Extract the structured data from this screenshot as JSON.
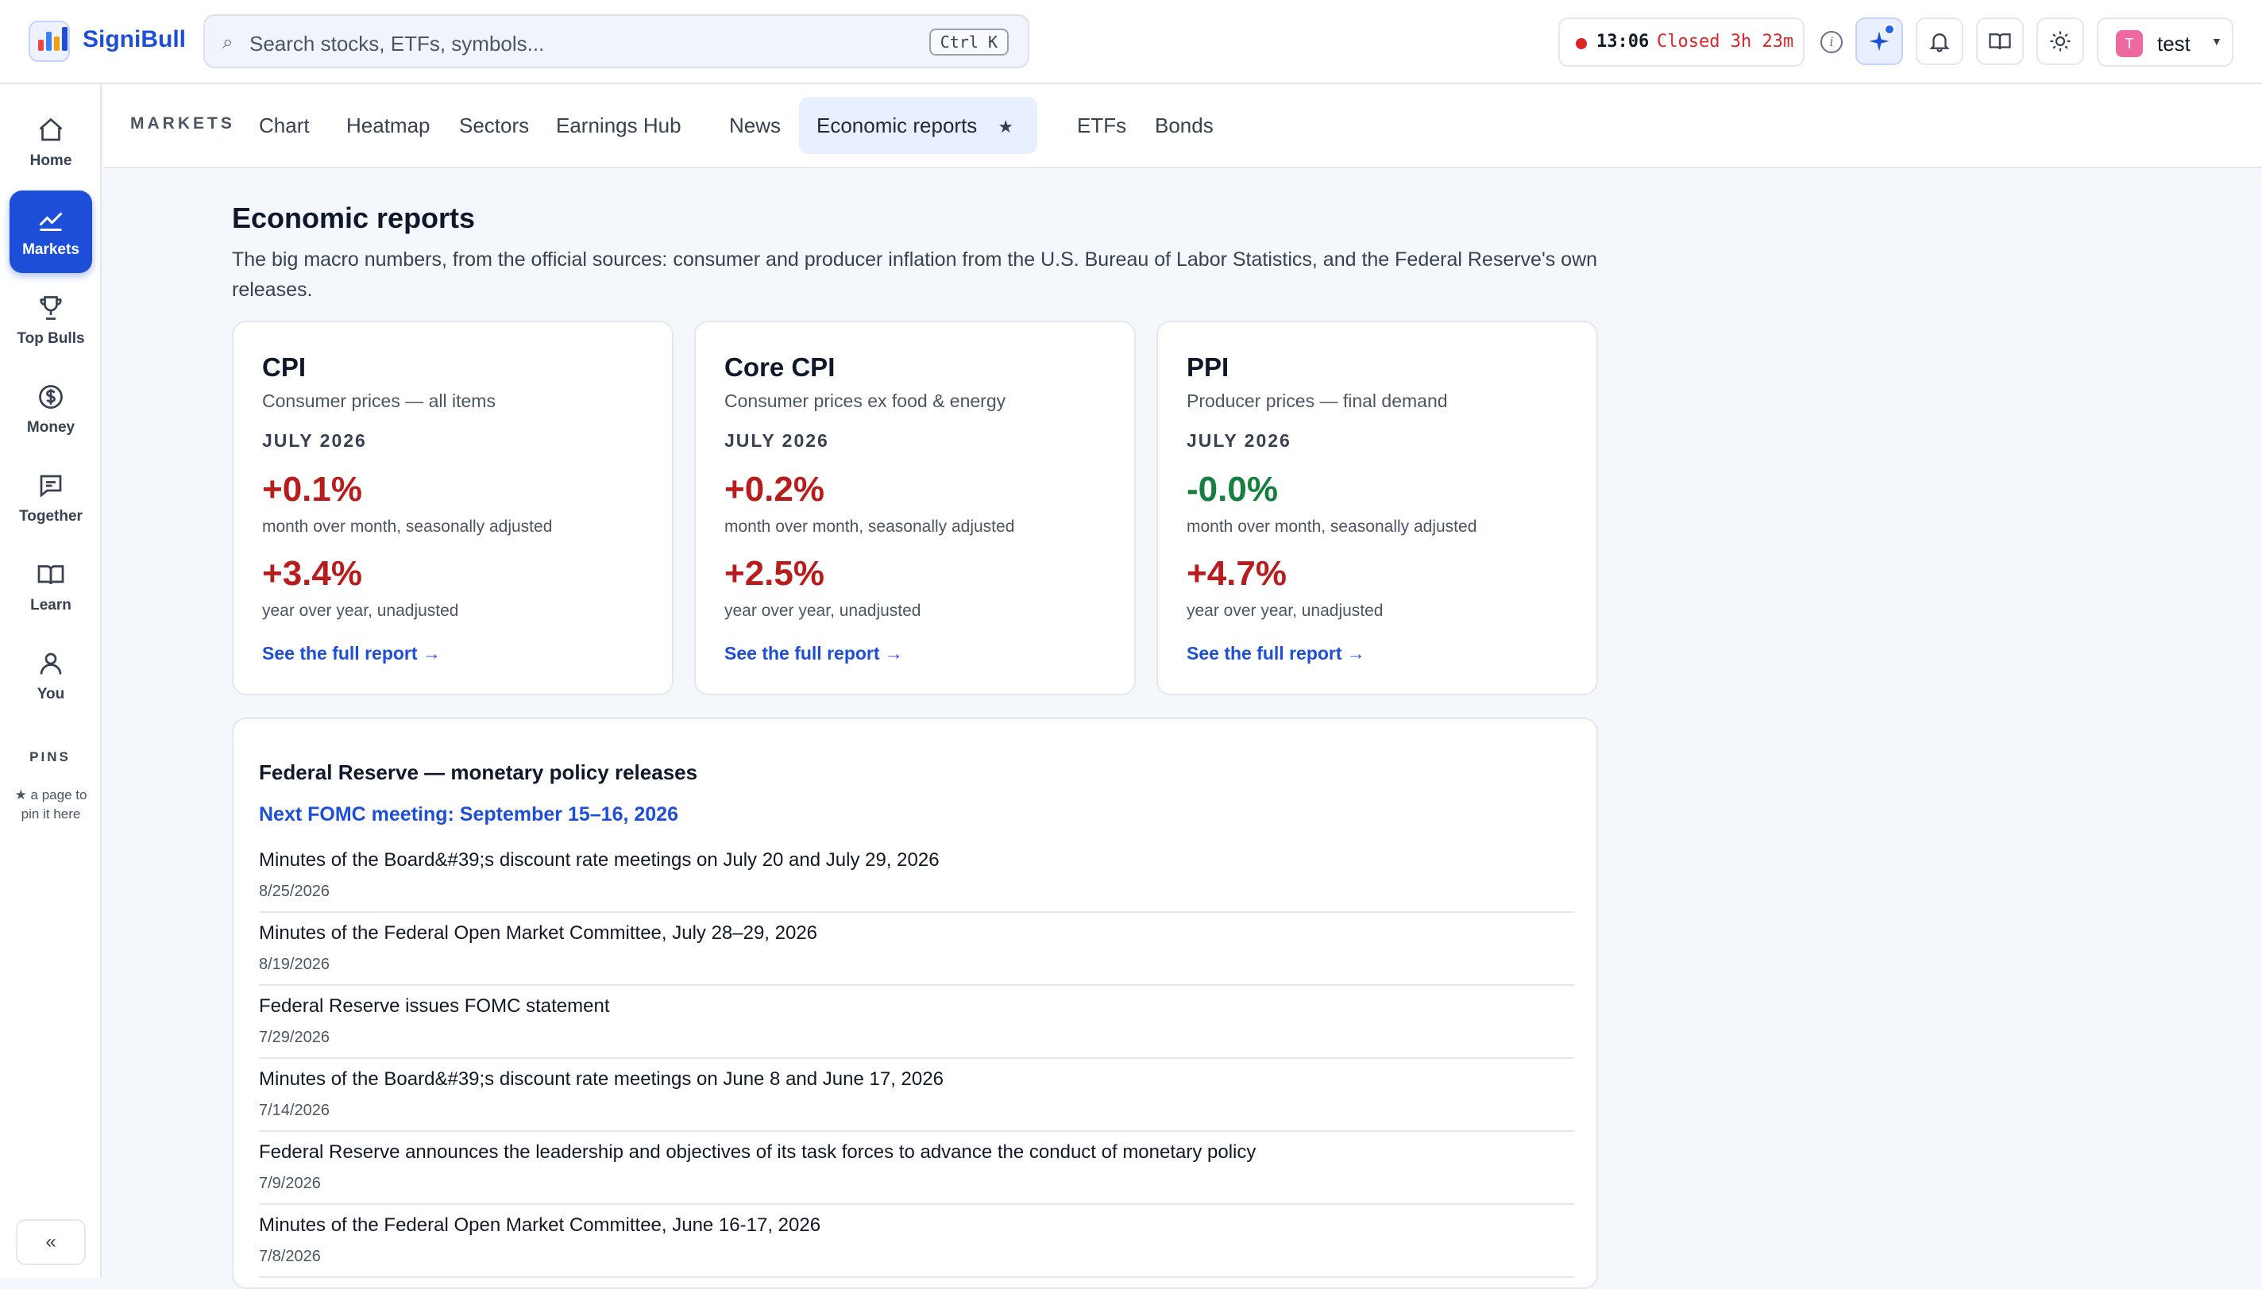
{
  "app": {
    "name": "SigniBull"
  },
  "search": {
    "placeholder": "Search stocks, ETFs, symbols...",
    "shortcut": "Ctrl K"
  },
  "market_status": {
    "time": "13:06",
    "state": "Closed 3h 23m"
  },
  "user": {
    "initial": "T",
    "name": "test"
  },
  "sidebar": {
    "items": [
      {
        "label": "Home"
      },
      {
        "label": "Markets"
      },
      {
        "label": "Top Bulls"
      },
      {
        "label": "Money"
      },
      {
        "label": "Together"
      },
      {
        "label": "Learn"
      },
      {
        "label": "You"
      }
    ],
    "pins_title": "PINS",
    "pins_hint": "★ a page to pin it here",
    "collapse": "«"
  },
  "subnav": {
    "title": "MARKETS",
    "tabs": [
      {
        "label": "Chart"
      },
      {
        "label": "Heatmap"
      },
      {
        "label": "Sectors"
      },
      {
        "label": "Earnings Hub"
      },
      {
        "label": "News"
      },
      {
        "label": "Economic reports",
        "star": "★"
      },
      {
        "label": "ETFs"
      },
      {
        "label": "Bonds"
      }
    ]
  },
  "page": {
    "title": "Economic reports",
    "description": "The big macro numbers, from the official sources: consumer and producer inflation from the U.S. Bureau of Labor Statistics, and the Federal Reserve's own releases."
  },
  "cards": [
    {
      "title": "CPI",
      "subtitle": "Consumer prices — all items",
      "period": "JULY 2026",
      "mom": "+0.1%",
      "mom_note": "month over month, seasonally adjusted",
      "yoy": "+3.4%",
      "yoy_note": "year over year, unadjusted",
      "link": "See the full report →"
    },
    {
      "title": "Core CPI",
      "subtitle": "Consumer prices ex food & energy",
      "period": "JULY 2026",
      "mom": "+0.2%",
      "mom_note": "month over month, seasonally adjusted",
      "yoy": "+2.5%",
      "yoy_note": "year over year, unadjusted",
      "link": "See the full report →"
    },
    {
      "title": "PPI",
      "subtitle": "Producer prices — final demand",
      "period": "JULY 2026",
      "mom": "-0.0%",
      "mom_note": "month over month, seasonally adjusted",
      "yoy": "+4.7%",
      "yoy_note": "year over year, unadjusted",
      "link": "See the full report →"
    }
  ],
  "colors": {
    "up": "#b91c1c",
    "down": "#15803d",
    "accent": "#1d4ed8"
  },
  "fed": {
    "title": "Federal Reserve — monetary policy releases",
    "next_meeting": "Next FOMC meeting: September 15–16, 2026",
    "items": [
      {
        "title": "Minutes of the Board&#39;s discount rate meetings on July 20 and July 29, 2026",
        "date": "8/25/2026"
      },
      {
        "title": "Minutes of the Federal Open Market Committee, July 28–29, 2026",
        "date": "8/19/2026"
      },
      {
        "title": "Federal Reserve issues FOMC statement",
        "date": "7/29/2026"
      },
      {
        "title": "Minutes of the Board&#39;s discount rate meetings on June 8 and June 17, 2026",
        "date": "7/14/2026"
      },
      {
        "title": "Federal Reserve announces the leadership and objectives of its task forces to advance the conduct of monetary policy",
        "date": "7/9/2026"
      },
      {
        "title": "Minutes of the Federal Open Market Committee, June 16-17, 2026",
        "date": "7/8/2026"
      }
    ]
  }
}
